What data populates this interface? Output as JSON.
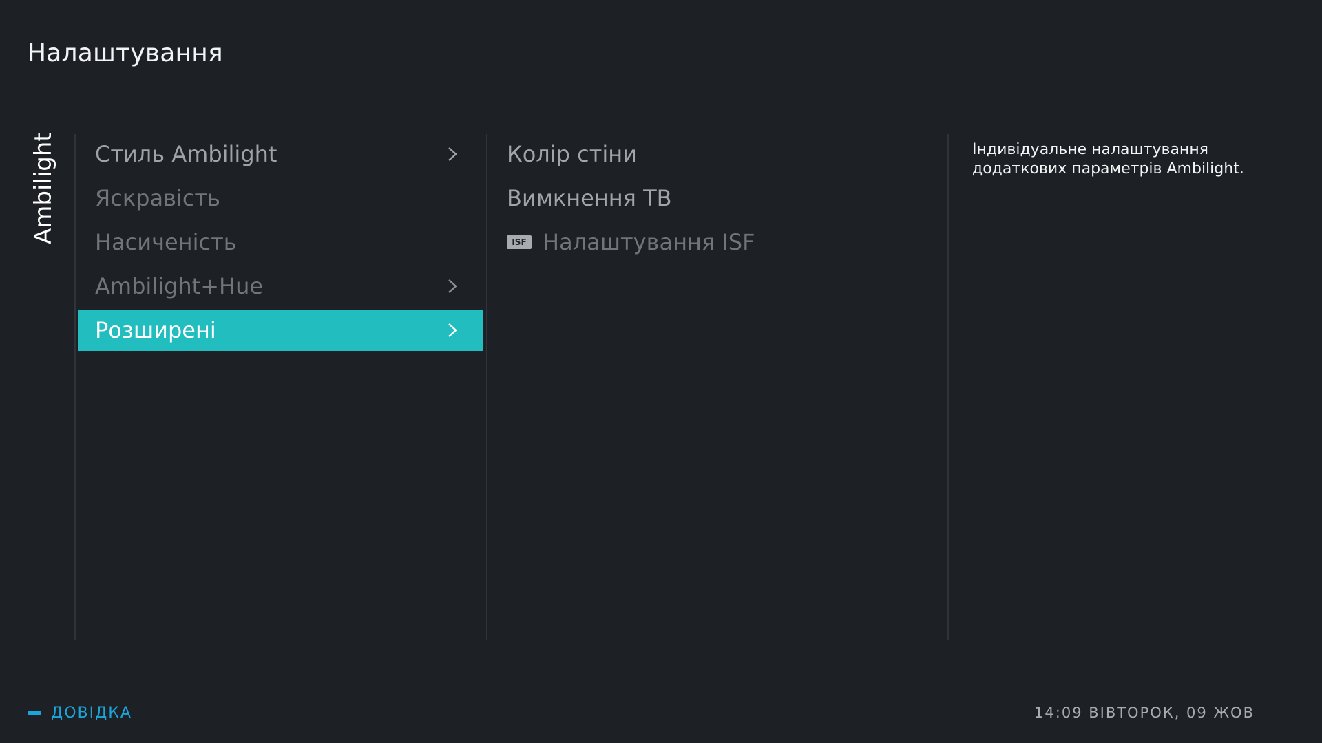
{
  "header": {
    "title": "Налаштування"
  },
  "side_tab": {
    "label": "Ambilight"
  },
  "menu": {
    "items": [
      {
        "label": "Стиль Ambilight",
        "state": "normal",
        "has_submenu": true
      },
      {
        "label": "Яскравість",
        "state": "disabled",
        "has_submenu": false
      },
      {
        "label": "Насиченість",
        "state": "disabled",
        "has_submenu": false
      },
      {
        "label": "Ambilight+Hue",
        "state": "disabled",
        "has_submenu": true
      },
      {
        "label": "Розширені",
        "state": "selected",
        "has_submenu": true
      }
    ]
  },
  "submenu": {
    "items": [
      {
        "label": "Колір стіни",
        "state": "normal"
      },
      {
        "label": "Вимкнення ТВ",
        "state": "normal"
      },
      {
        "label": "Налаштування ISF",
        "state": "disabled",
        "badge": "ISF"
      }
    ]
  },
  "description": "Індивідуальне налаштування додаткових параметрів Ambilight.",
  "footer": {
    "help_label": "ДОВІДКА",
    "clock": "14:09 ВІВТОРОК, 09 ЖОВ"
  },
  "colors": {
    "background": "#1d2024",
    "accent": "#22bebf",
    "help": "#1aa6db"
  }
}
